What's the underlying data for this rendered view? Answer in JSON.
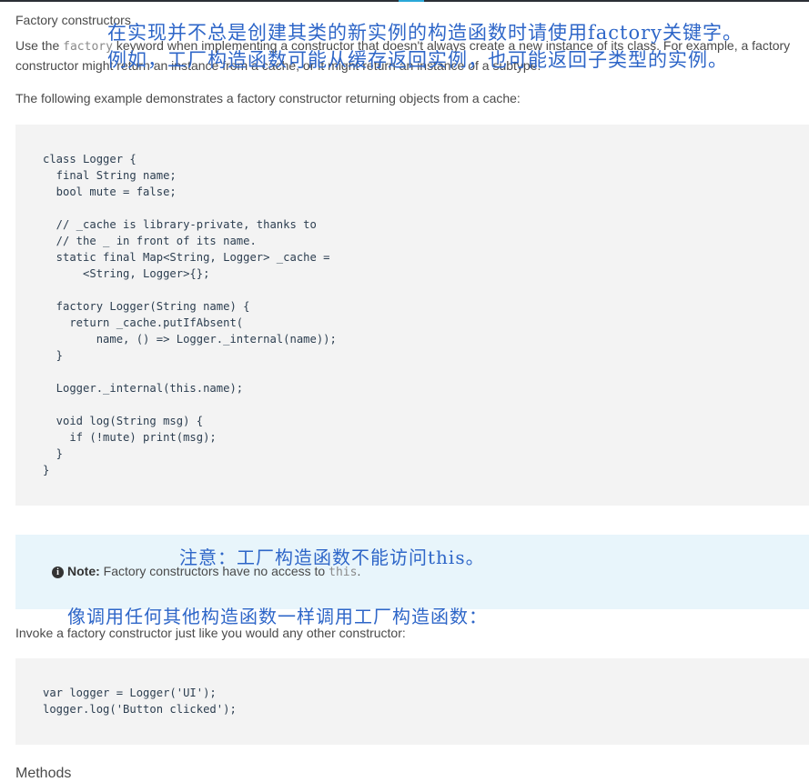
{
  "header": {
    "heading": "Factory constructors"
  },
  "intro": {
    "before_code": "Use the ",
    "keyword": "factory",
    "after_code": " keyword when implementing a constructor that doesn't always create a new instance of its class. For example, a factory constructor might return an instance from a cache, or it might return an instance of a subtype."
  },
  "example_intro": "The following example demonstrates a factory constructor returning objects from a cache:",
  "code_block_1": "class Logger {\n  final String name;\n  bool mute = false;\n\n  // _cache is library-private, thanks to\n  // the _ in front of its name.\n  static final Map<String, Logger> _cache =\n      <String, Logger>{};\n\n  factory Logger(String name) {\n    return _cache.putIfAbsent(\n        name, () => Logger._internal(name));\n  }\n\n  Logger._internal(this.name);\n\n  void log(String msg) {\n    if (!mute) print(msg);\n  }\n}",
  "translations": {
    "line1": "在实现并不总是创建其类的新实例的构造函数时请使用factory关键字。",
    "line2": "例如，工厂构造函数可能从缓存返回实例，也可能返回子类型的实例。",
    "note": "注意：工厂构造函数不能访问this。",
    "invoke": "像调用任何其他构造函数一样调用工厂构造函数："
  },
  "note": {
    "icon": "info-icon",
    "label": "Note:",
    "text": " Factory constructors have no access to ",
    "code": "this",
    "end": "."
  },
  "invoke_text": "Invoke a factory constructor just like you would any other constructor:",
  "code_block_2": "var logger = Logger('UI');\nlogger.log('Button clicked');",
  "next_heading": "Methods",
  "colors": {
    "translation": "#2e66c8",
    "note_bg": "#e8f5fb",
    "code_bg": "#f3f3f3",
    "accent": "#2aa8d8"
  }
}
